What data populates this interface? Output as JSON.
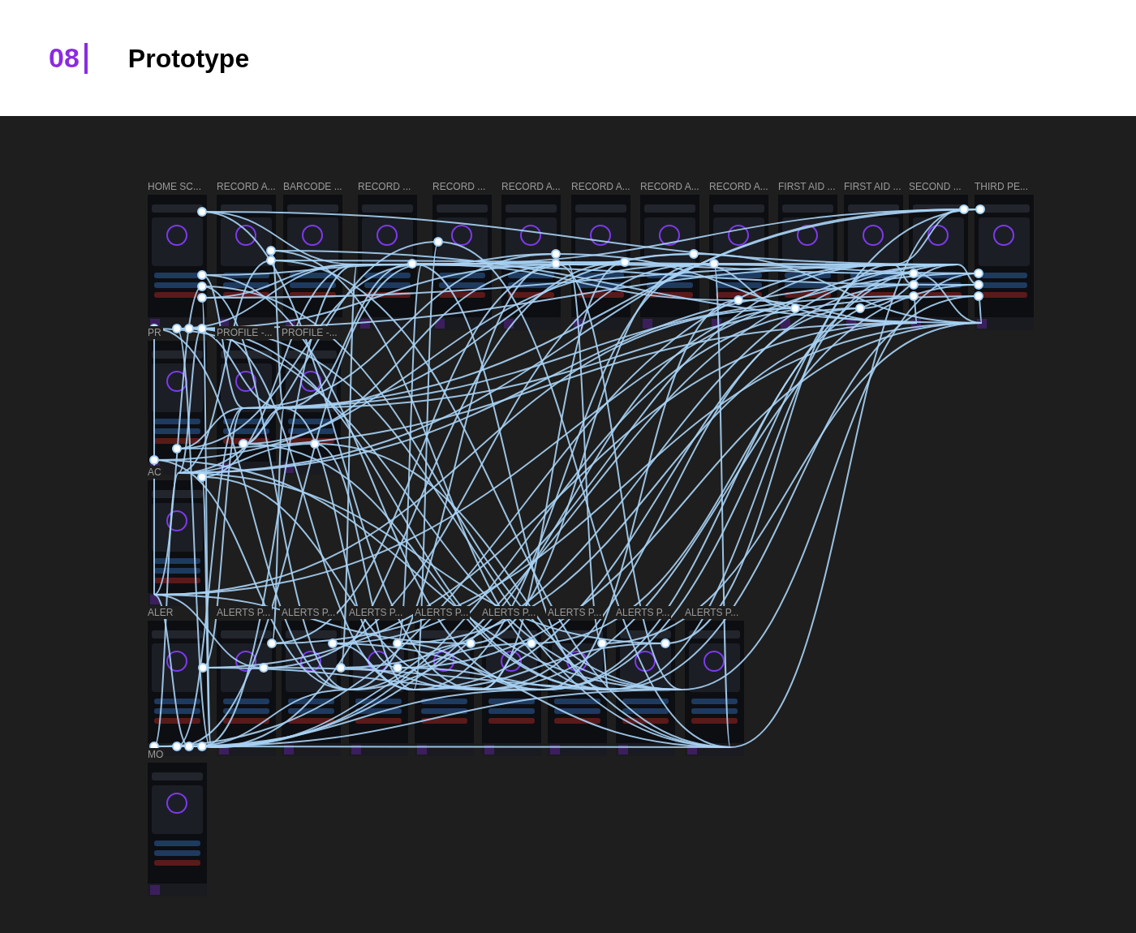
{
  "header": {
    "number": "08",
    "title": "Prototype"
  },
  "frames": [
    {
      "label": "HOME SC..."
    },
    {
      "label": "RECORD A..."
    },
    {
      "label": "BARCODE ..."
    },
    {
      "label": "RECORD ..."
    },
    {
      "label": "RECORD ..."
    },
    {
      "label": "RECORD A..."
    },
    {
      "label": "RECORD A..."
    },
    {
      "label": "RECORD A..."
    },
    {
      "label": "RECORD A..."
    },
    {
      "label": "FIRST AID ..."
    },
    {
      "label": "FIRST AID ..."
    },
    {
      "label": "SECOND ..."
    },
    {
      "label": "THIRD PE..."
    },
    {
      "label": "PR"
    },
    {
      "label": "PROFILE -..."
    },
    {
      "label": "PROFILE -..."
    },
    {
      "label": "AC"
    },
    {
      "label": "ALER"
    },
    {
      "label": "ALERTS P..."
    },
    {
      "label": "ALERTS P..."
    },
    {
      "label": "ALERTS P..."
    },
    {
      "label": "ALERTS P..."
    },
    {
      "label": "ALERTS P..."
    },
    {
      "label": "ALERTS P..."
    },
    {
      "label": "ALERTS P..."
    },
    {
      "label": "ALERTS P..."
    },
    {
      "label": "MO"
    }
  ]
}
